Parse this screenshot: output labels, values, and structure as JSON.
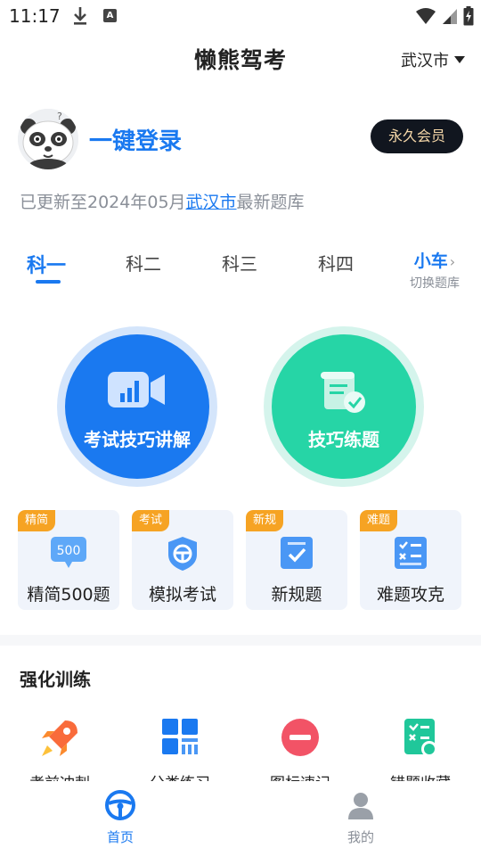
{
  "status_bar": {
    "time": "11:17",
    "a_badge": "A"
  },
  "header": {
    "title": "懒熊驾考",
    "city": "武汉市"
  },
  "profile": {
    "login_text": "一键登录",
    "vip_label": "永久会员",
    "update_prefix": "已更新至2024年05月",
    "update_city": "武汉市",
    "update_suffix": "最新题库"
  },
  "tabs": [
    {
      "label": "科一",
      "active": true
    },
    {
      "label": "科二",
      "active": false
    },
    {
      "label": "科三",
      "active": false
    },
    {
      "label": "科四",
      "active": false
    }
  ],
  "switch_car": {
    "label": "小车",
    "sub": "切换题库"
  },
  "big_buttons": [
    {
      "label": "考试技巧讲解",
      "color": "#1a79f0",
      "icon": "video-icon"
    },
    {
      "label": "技巧练题",
      "color": "#26d5a6",
      "icon": "scroll-check-icon"
    }
  ],
  "quick_cards": [
    {
      "badge": "精简",
      "label": "精简500题",
      "icon_text": "500",
      "icon": "bubble-500-icon"
    },
    {
      "badge": "考试",
      "label": "模拟考试",
      "icon": "steering-shield-icon"
    },
    {
      "badge": "新规",
      "label": "新规题",
      "icon": "checkbox-icon"
    },
    {
      "badge": "难题",
      "label": "难题攻克",
      "icon": "list-check-icon"
    }
  ],
  "section": {
    "title": "强化训练"
  },
  "training": [
    {
      "label": "考前冲刺",
      "icon": "rocket-icon"
    },
    {
      "label": "分类练习",
      "icon": "grid-icon"
    },
    {
      "label": "图标速记",
      "icon": "no-entry-icon"
    },
    {
      "label": "错题收藏",
      "icon": "wrong-list-icon"
    }
  ],
  "bottom_nav": [
    {
      "label": "首页",
      "icon": "steering-wheel-icon",
      "active": true
    },
    {
      "label": "我的",
      "icon": "person-icon",
      "active": false
    }
  ],
  "colors": {
    "primary": "#1a79f0",
    "green": "#26d5a6",
    "badge": "#f6a323",
    "vip_bg": "#11161f",
    "vip_text": "#f5d7a8"
  }
}
